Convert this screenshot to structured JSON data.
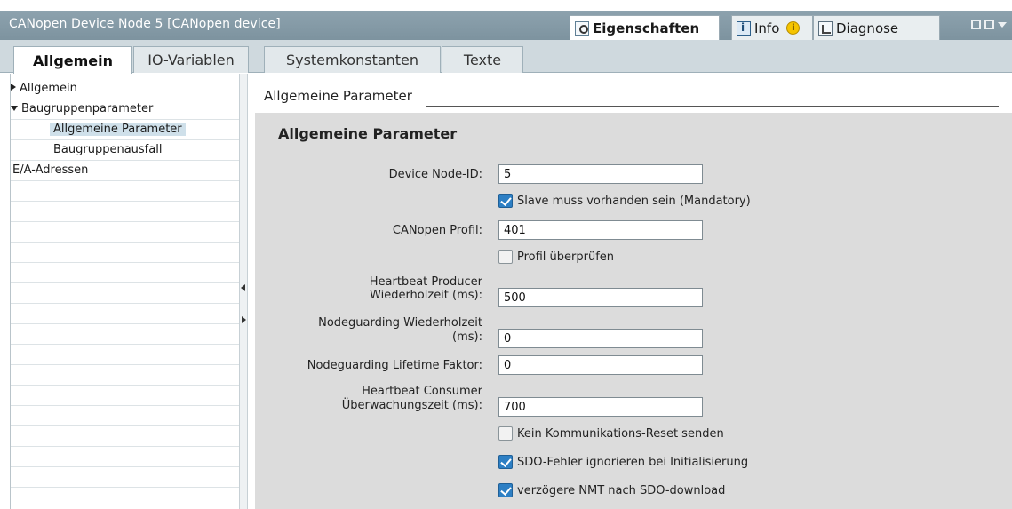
{
  "window": {
    "title": "CANopen Device Node 5 [CANopen device]",
    "right_tabs": [
      {
        "label": "Eigenschaften",
        "icon": "properties-icon"
      },
      {
        "label": "Info",
        "icon": "info-icon"
      },
      {
        "label": "Diagnose",
        "icon": "diagnose-icon"
      }
    ],
    "info_badge": "i"
  },
  "tabs": [
    {
      "label": "Allgemein"
    },
    {
      "label": "IO-Variablen"
    },
    {
      "label": "Systemkonstanten"
    },
    {
      "label": "Texte"
    }
  ],
  "nav": {
    "items": [
      {
        "label": "Allgemein"
      },
      {
        "label": "Baugruppenparameter"
      },
      {
        "label": "Allgemeine Parameter"
      },
      {
        "label": "Baugruppenausfall"
      },
      {
        "label": "E/A-Adressen"
      }
    ]
  },
  "main": {
    "section_heading": "Allgemeine Parameter",
    "panel_title": "Allgemeine Parameter",
    "fields": {
      "node_id": {
        "label": "Device Node-ID:",
        "value": "5"
      },
      "mandatory": {
        "label": "Slave muss vorhanden sein (Mandatory)",
        "checked": true
      },
      "profil": {
        "label": "CANopen Profil:",
        "value": "401"
      },
      "profil_check": {
        "label": "Profil überprüfen",
        "checked": false
      },
      "heartbeat_producer": {
        "label_line1": "Heartbeat Producer",
        "label_line2": "Wiederholzeit (ms):",
        "value": "500"
      },
      "nodeguarding_time": {
        "label_line1": "Nodeguarding Wiederholzeit",
        "label_line2": "(ms):",
        "value": "0"
      },
      "nodeguarding_lifetime": {
        "label": "Nodeguarding Lifetime Faktor:",
        "value": "0"
      },
      "heartbeat_consumer": {
        "label_line1": "Heartbeat Consumer",
        "label_line2": "Überwachungszeit (ms):",
        "value": "700"
      },
      "no_reset": {
        "label": "Kein Kommunikations-Reset senden",
        "checked": false
      },
      "sdo_errors": {
        "label": "SDO-Fehler ignorieren bei Initialisierung",
        "checked": true
      },
      "nmt_delay": {
        "label": "verzögere NMT nach SDO-download",
        "checked": true
      }
    }
  },
  "colors": {
    "titlebar": "#8da2ae",
    "checkbox_on": "#2d7fc4",
    "panel_bg": "#dcdcdc",
    "nav_selected": "#cfe0ea"
  }
}
